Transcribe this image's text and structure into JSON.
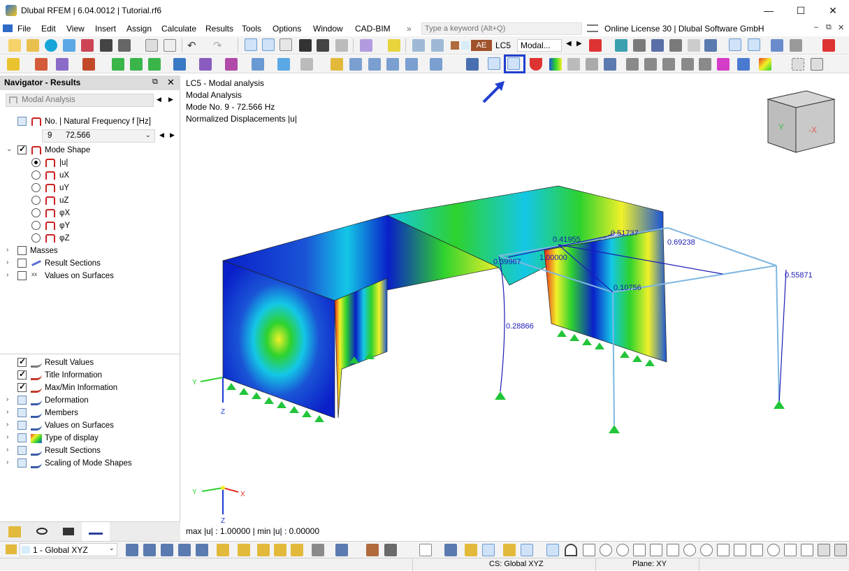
{
  "window": {
    "title": "Dlubal RFEM | 6.04.0012 | Tutorial.rf6",
    "minimize": "—",
    "maximize": "☐",
    "close": "✕"
  },
  "menu": [
    "File",
    "Edit",
    "View",
    "Insert",
    "Assign",
    "Calculate",
    "Results",
    "Tools",
    "Options",
    "Window",
    "CAD-BIM"
  ],
  "search": {
    "placeholder": "Type a keyword (Alt+Q)",
    "more": "»"
  },
  "license": "Online License 30 | Dlubal Software GmbH",
  "toolbar1": {
    "ae_label": "AE",
    "lc_label": "LC5",
    "modal_label": "Modal..."
  },
  "navigator": {
    "title": "Navigator - Results",
    "dropdown_label": "Modal Analysis",
    "freq_header": "No. | Natural Frequency f [Hz]",
    "mode_no": "9",
    "freq_value": "72.566",
    "mode_shape_label": "Mode Shape",
    "mode_options": [
      "|u|",
      "uX",
      "uY",
      "uZ",
      "φX",
      "φY",
      "φZ"
    ],
    "selected_option": "|u|",
    "upper_items": [
      "Masses",
      "Result Sections",
      "Values on Surfaces"
    ],
    "lower_items": [
      {
        "label": "Result Values",
        "checked": true
      },
      {
        "label": "Title Information",
        "checked": true
      },
      {
        "label": "Max/Min Information",
        "checked": true
      },
      {
        "label": "Deformation",
        "checked": false
      },
      {
        "label": "Members",
        "checked": false
      },
      {
        "label": "Values on Surfaces",
        "checked": false
      },
      {
        "label": "Type of display",
        "checked": false
      },
      {
        "label": "Result Sections",
        "checked": false
      },
      {
        "label": "Scaling of Mode Shapes",
        "checked": false
      }
    ]
  },
  "viewport": {
    "info_lines": [
      "LC5 - Modal analysis",
      "Modal Analysis",
      "Mode No. 9 - 72.566 Hz",
      "Normalized Displacements |u|"
    ],
    "maxmin": "max |u| : 1.00000 | min |u| : 0.00000",
    "values": [
      "0.51737",
      "0.41955",
      "0.69238",
      "0.39967",
      "1.00000",
      "0.55871",
      "0.10756",
      "0.28866"
    ],
    "axis_labels": {
      "x": "X",
      "y": "Y",
      "z": "Z",
      "cube_x": "-X",
      "cube_y": "Y"
    }
  },
  "bottom": {
    "view_select": "1 - Global XYZ"
  },
  "status": {
    "cs": "CS: Global XYZ",
    "plane": "Plane: XY"
  },
  "colors": {
    "accent_highlight": "#1f3fcf",
    "contour_blue": "#0a1fc8",
    "contour_cyan": "#14c7e6",
    "contour_green": "#2ed22e",
    "contour_yellow": "#f1f12a",
    "contour_red": "#e82a1a",
    "support_green": "#22c53a"
  }
}
